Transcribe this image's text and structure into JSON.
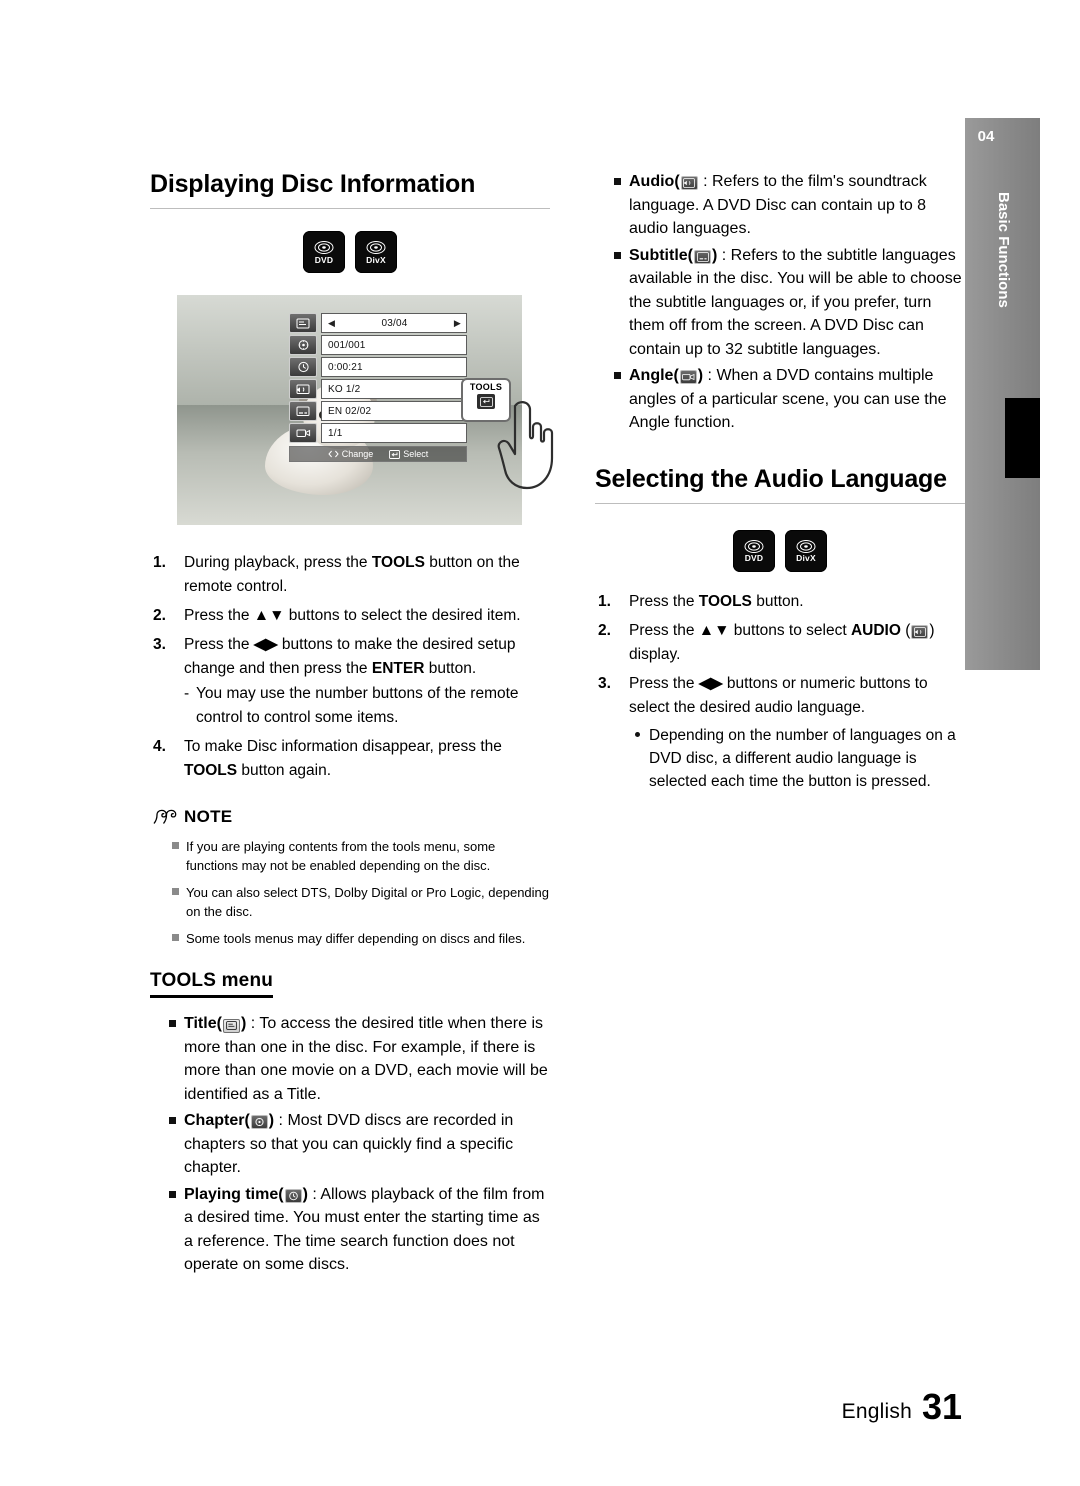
{
  "sidetab": {
    "number": "04",
    "label": "Basic Functions"
  },
  "left": {
    "title": "Displaying Disc Information",
    "badges": [
      {
        "name": "dvd-badge",
        "text": "DVD"
      },
      {
        "name": "divx-badge",
        "text": "DivX"
      }
    ],
    "osd": {
      "rows": [
        {
          "icon": "title-icon",
          "value": "03/04",
          "nav": true
        },
        {
          "icon": "chapter-icon",
          "value": "001/001",
          "nav": false
        },
        {
          "icon": "playing-time-icon",
          "value": "0:00:21",
          "nav": false
        },
        {
          "icon": "audio-icon",
          "value": "KO 1/2",
          "nav": false
        },
        {
          "icon": "subtitle-icon",
          "value": "EN 02/02",
          "nav": false
        },
        {
          "icon": "angle-icon",
          "value": "1/1",
          "nav": false
        }
      ],
      "footer": [
        {
          "icon": "left-right-arrows-icon",
          "label": "Change"
        },
        {
          "icon": "enter-icon",
          "label": "Select"
        }
      ]
    },
    "steps": [
      {
        "num": "1.",
        "parts": [
          {
            "t": "During playback, press the "
          },
          {
            "t": "TOOLS",
            "b": true
          },
          {
            "t": " button on the remote control."
          }
        ]
      },
      {
        "num": "2.",
        "parts": [
          {
            "t": "Press the "
          },
          {
            "t": "▲▼",
            "b": true
          },
          {
            "t": " buttons to select the desired item."
          }
        ]
      },
      {
        "num": "3.",
        "parts": [
          {
            "t": "Press the "
          },
          {
            "t": "◀▶",
            "b": true
          },
          {
            "t": " buttons to make the desired setup change and then press the "
          },
          {
            "t": "ENTER",
            "b": true
          },
          {
            "t": " button."
          }
        ],
        "sub": "You may use the number buttons of the remote control to control some items."
      },
      {
        "num": "4.",
        "parts": [
          {
            "t": "To make Disc information disappear, press the "
          },
          {
            "t": "TOOLS",
            "b": true
          },
          {
            "t": " button again."
          }
        ]
      }
    ],
    "remote_key_label": "TOOLS",
    "note": {
      "title": "NOTE",
      "items": [
        "If you are playing contents from the tools menu, some functions may not be enabled depending on the disc.",
        "You can also select DTS, Dolby Digital or Pro Logic, depending on the disc.",
        "Some tools menus may differ depending on discs and files."
      ]
    },
    "tools_menu": {
      "title": "TOOLS menu",
      "items": [
        {
          "name": "Title",
          "icon": "title-icon",
          "text": " : To access the desired title when there is more than one in the disc. For example, if there is more than one movie on a DVD, each movie will be identified as a Title."
        },
        {
          "name": "Chapter",
          "icon": "chapter-icon",
          "text": " : Most DVD discs are recorded in chapters so that you can quickly find a specific chapter."
        },
        {
          "name": "Playing time",
          "icon": "playing-time-icon",
          "text": " : Allows playback of the film from a desired time. You must enter the starting time as a reference. The time search function does not operate on some discs."
        }
      ]
    }
  },
  "right": {
    "bullets": [
      {
        "name": "Audio",
        "icon": "audio-icon",
        "text": " : Refers to the film's soundtrack language. A DVD Disc can contain up to 8 audio languages."
      },
      {
        "name": "Subtitle",
        "icon": "subtitle-icon",
        "text": " : Refers to the subtitle languages available in the disc. You will be able to choose the subtitle languages or, if you prefer, turn them off from the screen. A DVD Disc can contain up to 32 subtitle languages."
      },
      {
        "name": "Angle",
        "icon": "angle-icon",
        "text": " : When a DVD contains multiple angles of a particular scene, you can use the Angle function."
      }
    ],
    "title": "Selecting the Audio Language",
    "badges": [
      {
        "name": "dvd-badge",
        "text": "DVD"
      },
      {
        "name": "divx-badge",
        "text": "DivX"
      }
    ],
    "steps": [
      {
        "num": "1.",
        "parts": [
          {
            "t": "Press the "
          },
          {
            "t": "TOOLS",
            "b": true
          },
          {
            "t": " button."
          }
        ]
      },
      {
        "num": "2.",
        "parts": [
          {
            "t": "Press the "
          },
          {
            "t": "▲▼",
            "b": true
          },
          {
            "t": " buttons to select "
          },
          {
            "t": "AUDIO",
            "b": true
          },
          {
            "t": " ("
          },
          {
            "t": "__AUDIO_ICON__",
            "icon": true
          },
          {
            "t": ") display."
          }
        ]
      },
      {
        "num": "3.",
        "parts": [
          {
            "t": "Press the "
          },
          {
            "t": "◀▶",
            "b": true
          },
          {
            "t": " buttons or numeric buttons to select the desired audio language."
          }
        ]
      }
    ],
    "note_dot": "Depending on the number of languages on a DVD disc, a different audio language is selected each time the button is pressed."
  },
  "footer": {
    "language": "English",
    "page": "31"
  }
}
